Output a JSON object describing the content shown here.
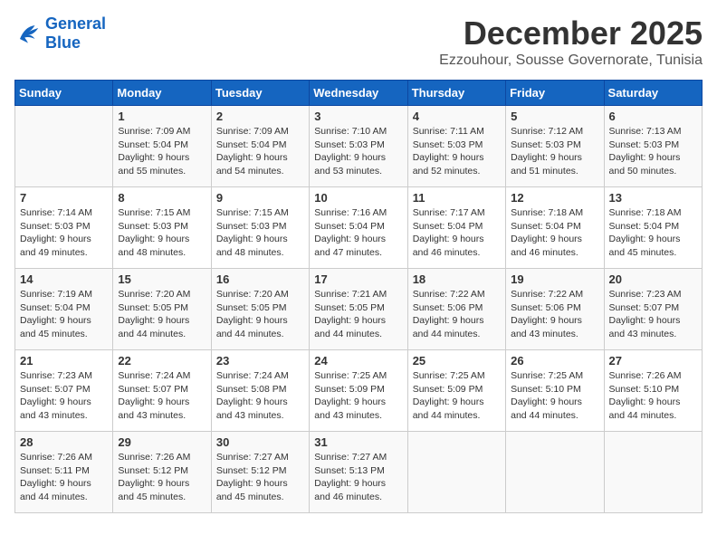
{
  "header": {
    "logo_line1": "General",
    "logo_line2": "Blue",
    "month": "December 2025",
    "location": "Ezzouhour, Sousse Governorate, Tunisia"
  },
  "days_of_week": [
    "Sunday",
    "Monday",
    "Tuesday",
    "Wednesday",
    "Thursday",
    "Friday",
    "Saturday"
  ],
  "weeks": [
    [
      {
        "day": "",
        "info": ""
      },
      {
        "day": "1",
        "info": "Sunrise: 7:09 AM\nSunset: 5:04 PM\nDaylight: 9 hours\nand 55 minutes."
      },
      {
        "day": "2",
        "info": "Sunrise: 7:09 AM\nSunset: 5:04 PM\nDaylight: 9 hours\nand 54 minutes."
      },
      {
        "day": "3",
        "info": "Sunrise: 7:10 AM\nSunset: 5:03 PM\nDaylight: 9 hours\nand 53 minutes."
      },
      {
        "day": "4",
        "info": "Sunrise: 7:11 AM\nSunset: 5:03 PM\nDaylight: 9 hours\nand 52 minutes."
      },
      {
        "day": "5",
        "info": "Sunrise: 7:12 AM\nSunset: 5:03 PM\nDaylight: 9 hours\nand 51 minutes."
      },
      {
        "day": "6",
        "info": "Sunrise: 7:13 AM\nSunset: 5:03 PM\nDaylight: 9 hours\nand 50 minutes."
      }
    ],
    [
      {
        "day": "7",
        "info": "Sunrise: 7:14 AM\nSunset: 5:03 PM\nDaylight: 9 hours\nand 49 minutes."
      },
      {
        "day": "8",
        "info": "Sunrise: 7:15 AM\nSunset: 5:03 PM\nDaylight: 9 hours\nand 48 minutes."
      },
      {
        "day": "9",
        "info": "Sunrise: 7:15 AM\nSunset: 5:03 PM\nDaylight: 9 hours\nand 48 minutes."
      },
      {
        "day": "10",
        "info": "Sunrise: 7:16 AM\nSunset: 5:04 PM\nDaylight: 9 hours\nand 47 minutes."
      },
      {
        "day": "11",
        "info": "Sunrise: 7:17 AM\nSunset: 5:04 PM\nDaylight: 9 hours\nand 46 minutes."
      },
      {
        "day": "12",
        "info": "Sunrise: 7:18 AM\nSunset: 5:04 PM\nDaylight: 9 hours\nand 46 minutes."
      },
      {
        "day": "13",
        "info": "Sunrise: 7:18 AM\nSunset: 5:04 PM\nDaylight: 9 hours\nand 45 minutes."
      }
    ],
    [
      {
        "day": "14",
        "info": "Sunrise: 7:19 AM\nSunset: 5:04 PM\nDaylight: 9 hours\nand 45 minutes."
      },
      {
        "day": "15",
        "info": "Sunrise: 7:20 AM\nSunset: 5:05 PM\nDaylight: 9 hours\nand 44 minutes."
      },
      {
        "day": "16",
        "info": "Sunrise: 7:20 AM\nSunset: 5:05 PM\nDaylight: 9 hours\nand 44 minutes."
      },
      {
        "day": "17",
        "info": "Sunrise: 7:21 AM\nSunset: 5:05 PM\nDaylight: 9 hours\nand 44 minutes."
      },
      {
        "day": "18",
        "info": "Sunrise: 7:22 AM\nSunset: 5:06 PM\nDaylight: 9 hours\nand 44 minutes."
      },
      {
        "day": "19",
        "info": "Sunrise: 7:22 AM\nSunset: 5:06 PM\nDaylight: 9 hours\nand 43 minutes."
      },
      {
        "day": "20",
        "info": "Sunrise: 7:23 AM\nSunset: 5:07 PM\nDaylight: 9 hours\nand 43 minutes."
      }
    ],
    [
      {
        "day": "21",
        "info": "Sunrise: 7:23 AM\nSunset: 5:07 PM\nDaylight: 9 hours\nand 43 minutes."
      },
      {
        "day": "22",
        "info": "Sunrise: 7:24 AM\nSunset: 5:07 PM\nDaylight: 9 hours\nand 43 minutes."
      },
      {
        "day": "23",
        "info": "Sunrise: 7:24 AM\nSunset: 5:08 PM\nDaylight: 9 hours\nand 43 minutes."
      },
      {
        "day": "24",
        "info": "Sunrise: 7:25 AM\nSunset: 5:09 PM\nDaylight: 9 hours\nand 43 minutes."
      },
      {
        "day": "25",
        "info": "Sunrise: 7:25 AM\nSunset: 5:09 PM\nDaylight: 9 hours\nand 44 minutes."
      },
      {
        "day": "26",
        "info": "Sunrise: 7:25 AM\nSunset: 5:10 PM\nDaylight: 9 hours\nand 44 minutes."
      },
      {
        "day": "27",
        "info": "Sunrise: 7:26 AM\nSunset: 5:10 PM\nDaylight: 9 hours\nand 44 minutes."
      }
    ],
    [
      {
        "day": "28",
        "info": "Sunrise: 7:26 AM\nSunset: 5:11 PM\nDaylight: 9 hours\nand 44 minutes."
      },
      {
        "day": "29",
        "info": "Sunrise: 7:26 AM\nSunset: 5:12 PM\nDaylight: 9 hours\nand 45 minutes."
      },
      {
        "day": "30",
        "info": "Sunrise: 7:27 AM\nSunset: 5:12 PM\nDaylight: 9 hours\nand 45 minutes."
      },
      {
        "day": "31",
        "info": "Sunrise: 7:27 AM\nSunset: 5:13 PM\nDaylight: 9 hours\nand 46 minutes."
      },
      {
        "day": "",
        "info": ""
      },
      {
        "day": "",
        "info": ""
      },
      {
        "day": "",
        "info": ""
      }
    ]
  ]
}
